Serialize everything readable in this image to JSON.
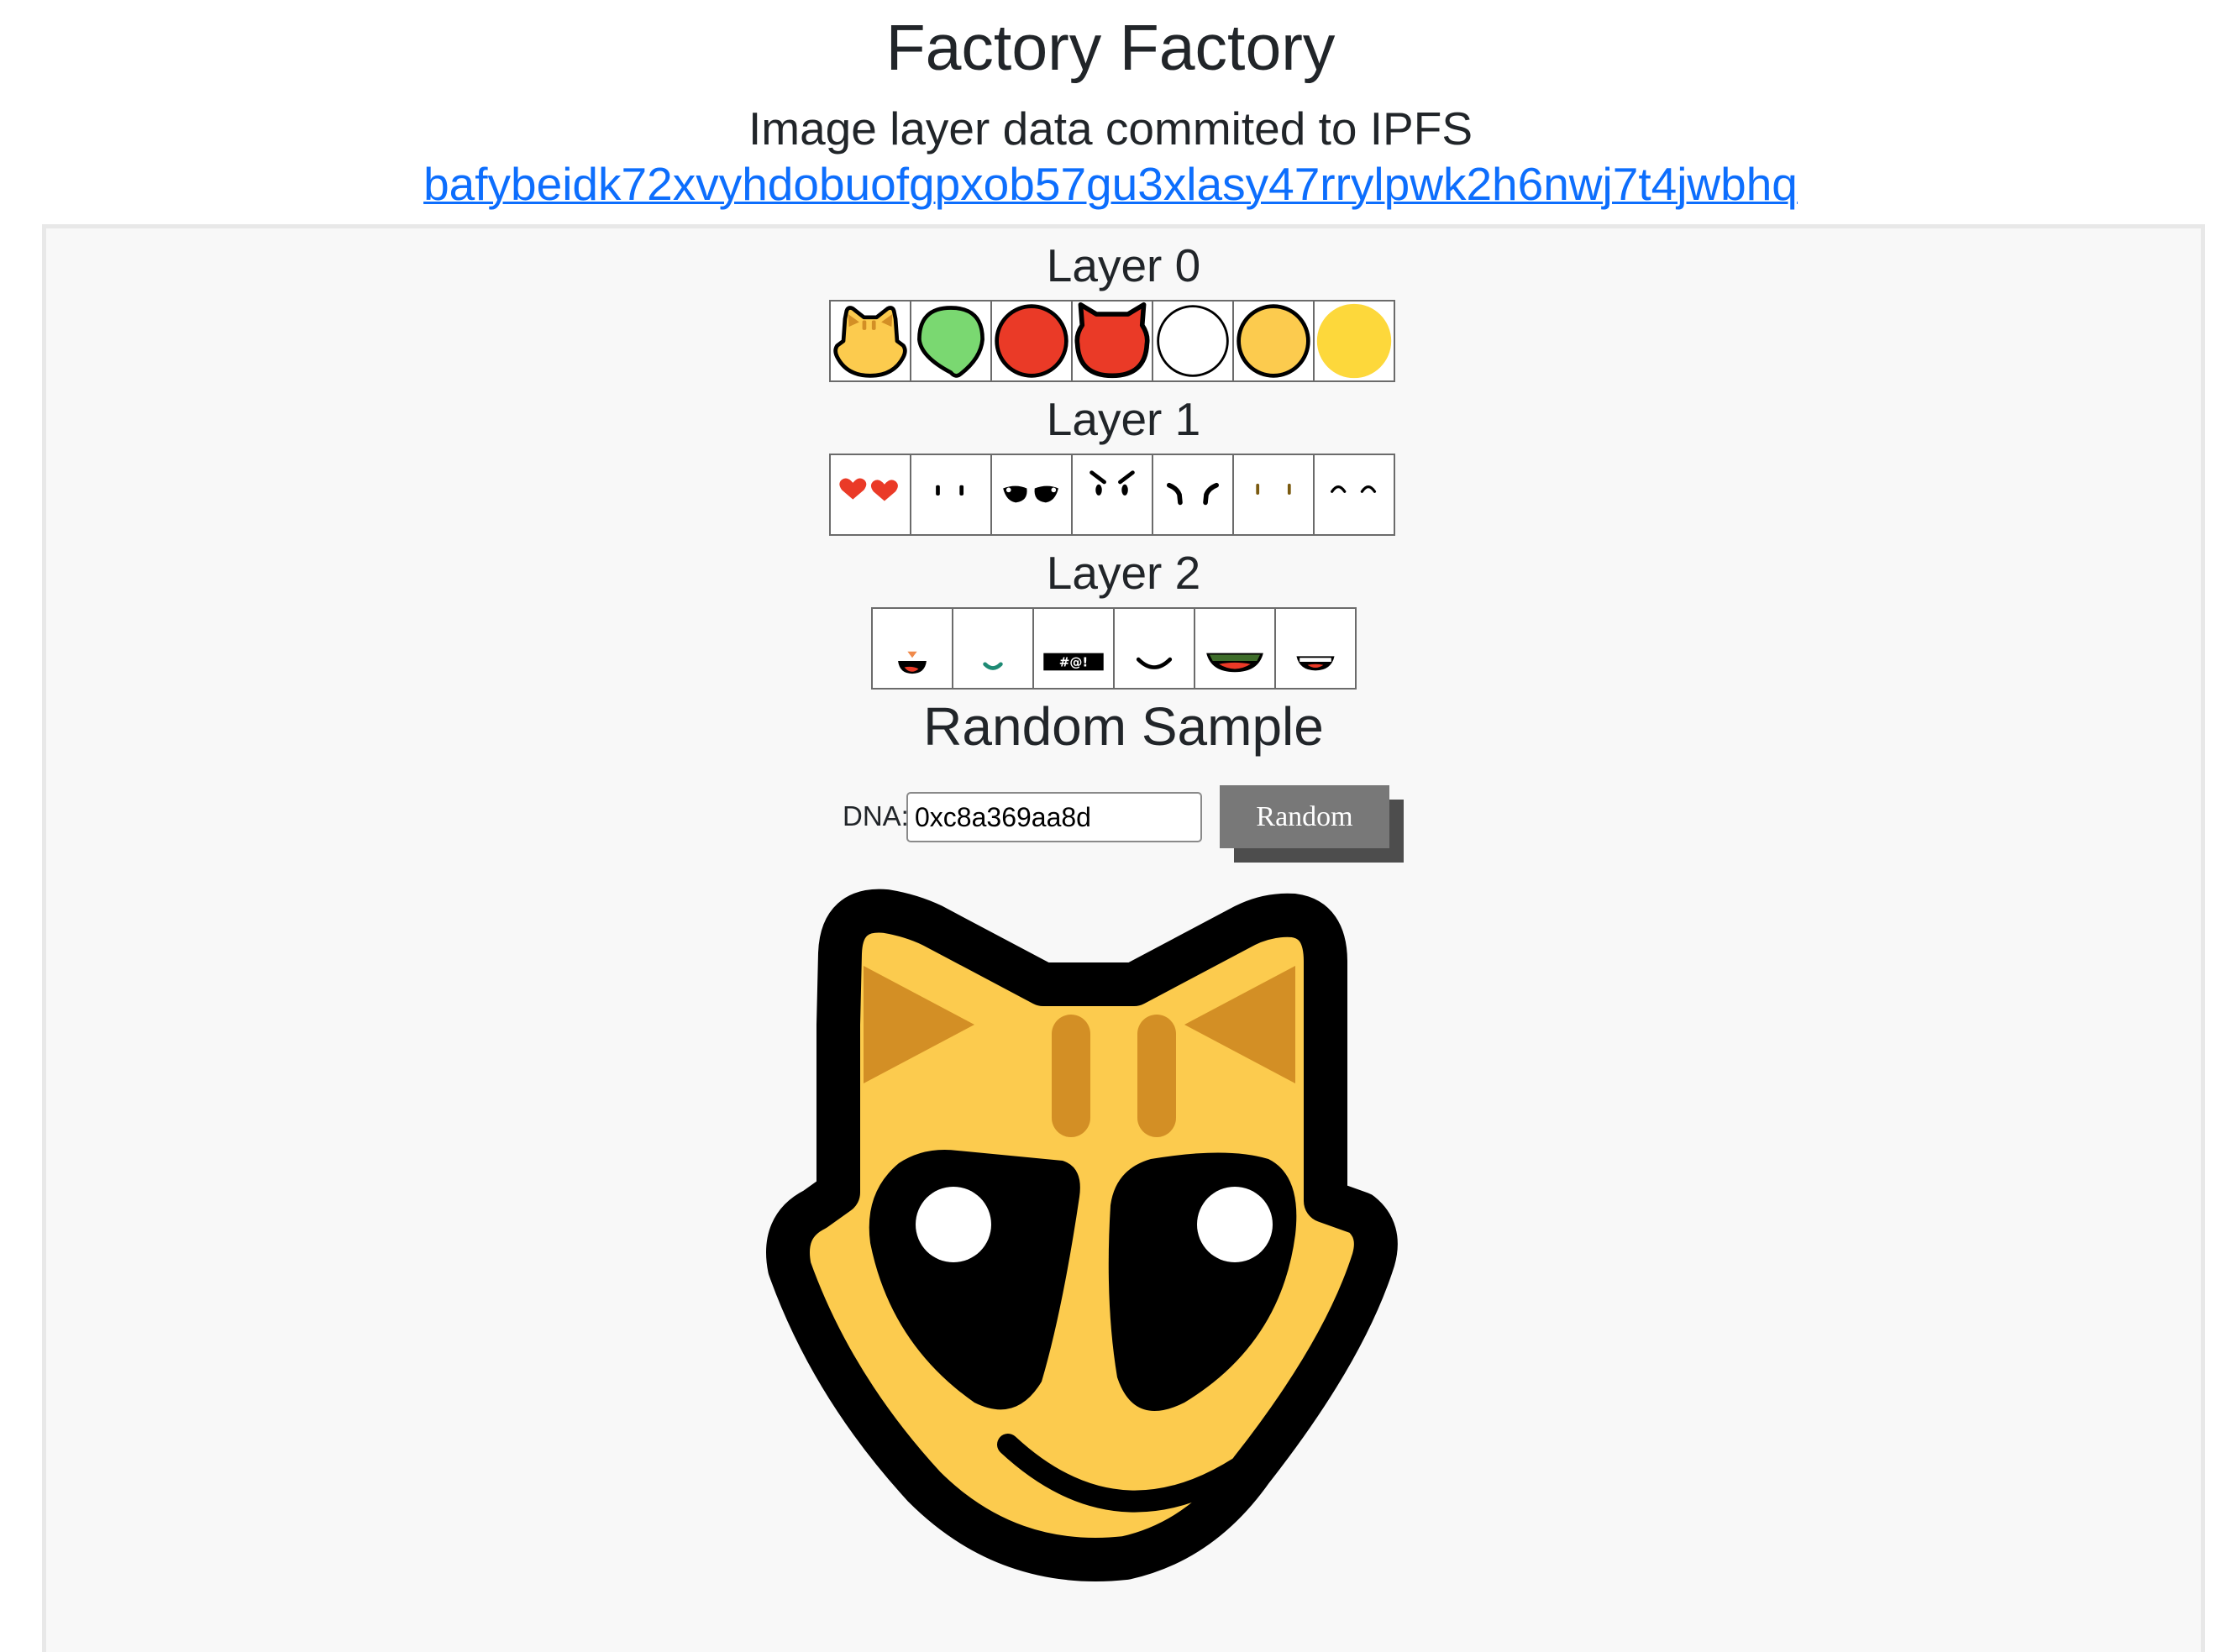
{
  "header": {
    "title": "Factory Factory",
    "subtitle": "Image layer data commited to IPFS",
    "cid": "bafybeidk72xvyhdobuofgpxob57gu3xlasy47rrylpwk2h6nwj7t4jwbhq"
  },
  "layers": [
    {
      "title": "Layer 0",
      "tiles": [
        "cat-head",
        "green-alien-head",
        "red-circle",
        "red-devil-head",
        "white-circle",
        "orange-circle",
        "yellow-circle"
      ]
    },
    {
      "title": "Layer 1",
      "tiles": [
        "heart-eyes",
        "dot-eyes",
        "alien-eyes",
        "angry-eyes",
        "sad-eyes",
        "slit-eyes",
        "happy-closed-eyes"
      ]
    },
    {
      "title": "Layer 2",
      "tiles": [
        "tongue-mouth",
        "small-smile-mouth",
        "cursing-mouth",
        "smile-mouth",
        "grin-mouth",
        "teeth-mouth"
      ]
    }
  ],
  "sample": {
    "title": "Random Sample",
    "dna_label": "DNA:",
    "dna_value": "0xc8a369aa8d",
    "random_label": "Random"
  },
  "colors": {
    "link": "#0d6efd",
    "panel_bg": "#f8f8f8",
    "cat_yellow": "#FCCB4E",
    "cat_stripe": "#D38F25",
    "red": "#EA3A27",
    "green": "#7AD871",
    "gold": "#FDD83B",
    "button": "#787878"
  }
}
